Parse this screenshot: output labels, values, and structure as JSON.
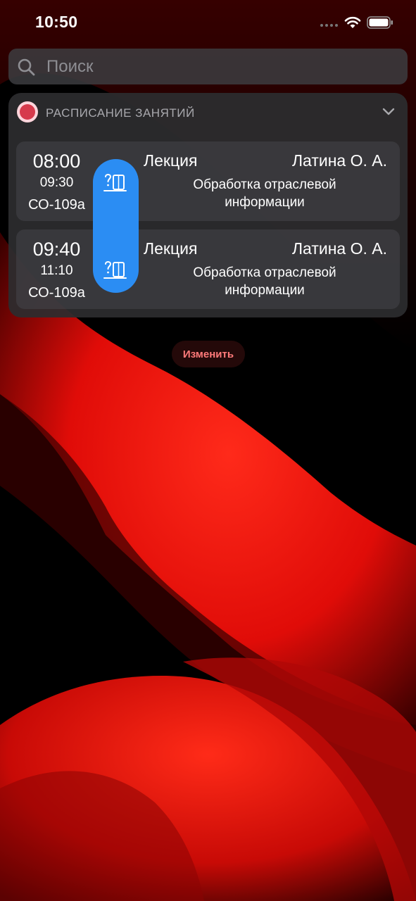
{
  "status_bar": {
    "time": "10:50",
    "icons": [
      "signal-dots-icon",
      "wifi-icon",
      "battery-icon"
    ]
  },
  "search": {
    "placeholder": "Поиск",
    "icon": "search-icon"
  },
  "widget": {
    "title": "РАСПИСАНИЕ ЗАНЯТИЙ",
    "app_icon": "university-emblem-icon",
    "expand_icon": "chevron-down-icon",
    "lessons": [
      {
        "start": "08:00",
        "end": "09:30",
        "room": "СО-109а",
        "type": "Лекция",
        "teacher": "Латина О. А.",
        "subject": "Обработка отраслевой информации"
      },
      {
        "start": "09:40",
        "end": "11:10",
        "room": "СО-109а",
        "type": "Лекция",
        "teacher": "Латина О. А.",
        "subject": "Обработка отраслевой информации"
      }
    ]
  },
  "drag_handle": {
    "icon": "help-book-icon"
  },
  "edit_button": {
    "label": "Изменить"
  },
  "colors": {
    "accent": "#2b8df3",
    "wallpaper_red": "#ff1a10",
    "background": "#000000",
    "edit_text": "#ff7a7a"
  }
}
